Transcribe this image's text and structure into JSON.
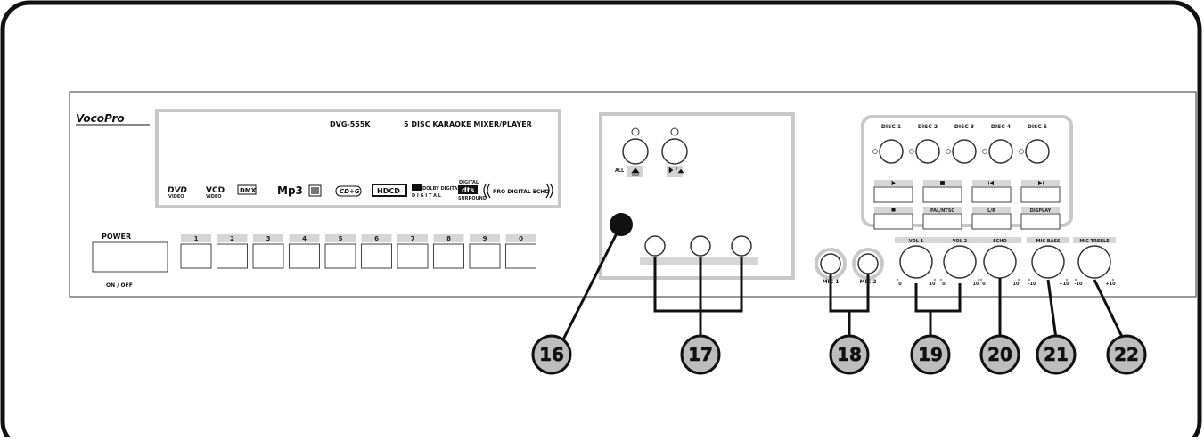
{
  "brand": "VocoPro",
  "model": "DVG-555K",
  "product_name": "5 DISC KARAOKE MIXER/PLAYER",
  "format_logos": [
    "DVD",
    "VCD",
    "DMX",
    "Mp3",
    "CD+G",
    "HDCD",
    "DOLBY DIGITAL",
    "dts",
    "PRO DIGITAL ECHO"
  ],
  "logo_subtexts": {
    "dvd": "VIDEO",
    "vcd": "VIDEO",
    "dolby": "D I G I T A L",
    "dts_top": "DIGITAL",
    "dts_bottom": "SURROUND"
  },
  "power": {
    "label": "POWER",
    "sublabel": "ON / OFF"
  },
  "number_buttons": [
    "1",
    "2",
    "3",
    "4",
    "5",
    "6",
    "7",
    "8",
    "9",
    "0"
  ],
  "tray": {
    "all_label": "ALL"
  },
  "disc_buttons": [
    "DISC 1",
    "DISC 2",
    "DISC 3",
    "DISC 4",
    "DISC 5"
  ],
  "control_labels": [
    "PAL/NTSC",
    "L/R",
    "DISPLAY"
  ],
  "mic_labels": [
    "MIC 1",
    "MIC 2"
  ],
  "knobs": [
    {
      "label": "VOL 1",
      "min": "0",
      "max": "10"
    },
    {
      "label": "VOL 2",
      "min": "0",
      "max": "10"
    },
    {
      "label": "ECHO",
      "min": "0",
      "max": "10"
    },
    {
      "label": "MIC BASS",
      "min": "-10",
      "max": "+10"
    },
    {
      "label": "MIC TREBLE",
      "min": "-10",
      "max": "+10"
    }
  ],
  "callouts": [
    "16",
    "17",
    "18",
    "19",
    "20",
    "21",
    "22"
  ]
}
